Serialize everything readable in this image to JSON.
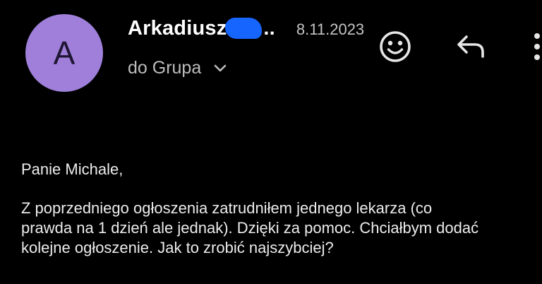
{
  "message": {
    "avatar_letter": "A",
    "sender_name": "Arkadiusz",
    "sender_suffix": "..",
    "date": "8.11.2023",
    "recipient_label": "do Grupa",
    "greeting": "Panie Michale,",
    "body": "Z poprzedniego ogłoszenia zatrudniłem jednego lekarza (co\nprawda na 1 dzień ale jednak). Dzięki za pomoc. Chciałbym dodać\nkolejne ogłoszenie. Jak to zrobić najszybciej?"
  },
  "icons": {
    "emoji": "emoji-smile-icon",
    "reply": "reply-arrow-icon",
    "more": "more-vertical-icon",
    "expand": "chevron-down-icon"
  },
  "colors": {
    "background": "#000000",
    "avatar": "#9f7fd9",
    "redaction": "#1765ff"
  }
}
